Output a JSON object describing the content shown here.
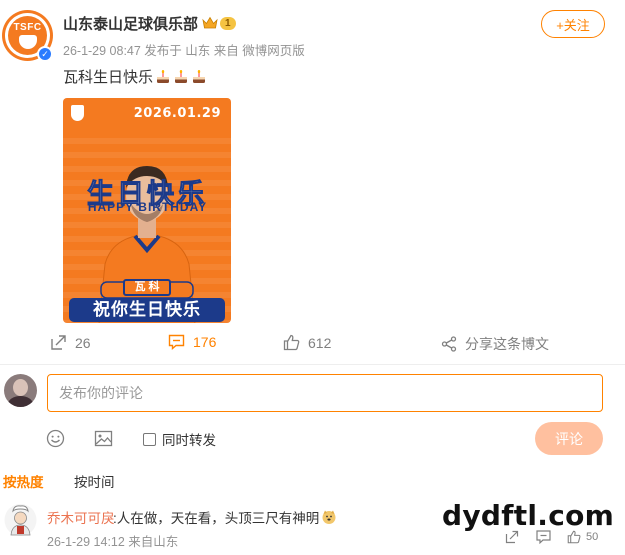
{
  "post": {
    "author": "山东泰山足球俱乐部",
    "avatar_abbr": "TSFC",
    "vip_level": "1",
    "meta": "26-1-29 08:47 发布于 山东 来自 微博网页版",
    "follow_label": "+关注",
    "text": "瓦科生日快乐",
    "emoji": "cake-icon",
    "image": {
      "date": "2026.01.29",
      "title": "生日快乐",
      "subtitle": "HAPPY BIRTHDAY",
      "name": "瓦 科",
      "wish": "祝你生日快乐"
    }
  },
  "actions": {
    "repost_count": "26",
    "comment_count": "176",
    "like_count": "612",
    "share_label": "分享这条博文"
  },
  "composer": {
    "placeholder": "发布你的评论",
    "repost_label": "同时转发",
    "submit_label": "评论"
  },
  "sort": {
    "hot": "按热度",
    "time": "按时间"
  },
  "comments": [
    {
      "user": "乔木可可戾",
      "text": ":人在做，天在看，头顶三尺有神明",
      "meta": "26-1-29 14:12 来自山东",
      "likes": "50"
    }
  ],
  "watermark": "dydftl.com",
  "colors": {
    "accent": "#ff8200",
    "club_orange": "#f47a20",
    "club_blue": "#1c3a8a",
    "username_comment": "#eb7350",
    "submit_disabled": "#ffc09f"
  }
}
